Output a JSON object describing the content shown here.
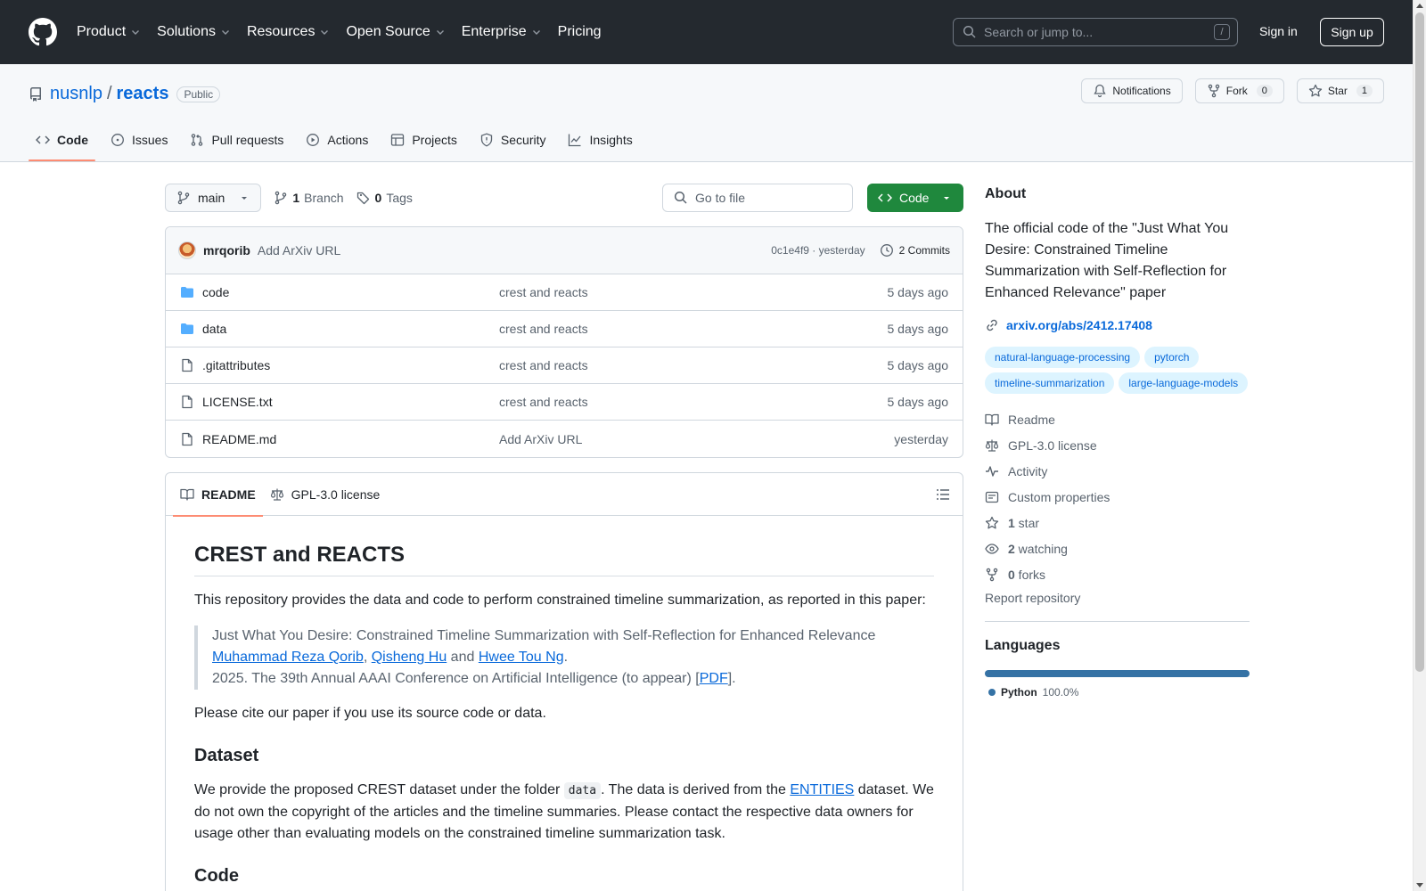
{
  "header": {
    "nav": [
      "Product",
      "Solutions",
      "Resources",
      "Open Source",
      "Enterprise"
    ],
    "pricing": "Pricing",
    "search_placeholder": "Search or jump to...",
    "search_key": "/",
    "sign_in": "Sign in",
    "sign_up": "Sign up"
  },
  "repo": {
    "owner": "nusnlp",
    "name": "reacts",
    "visibility": "Public",
    "notifications": "Notifications",
    "fork_label": "Fork",
    "fork_count": "0",
    "star_label": "Star",
    "star_count": "1",
    "tabs": [
      "Code",
      "Issues",
      "Pull requests",
      "Actions",
      "Projects",
      "Security",
      "Insights"
    ]
  },
  "toolbar": {
    "branch": "main",
    "branch_count": "1",
    "branch_label": "Branch",
    "tag_count": "0",
    "tag_label": "Tags",
    "goto_placeholder": "Go to file",
    "code_label": "Code"
  },
  "commit": {
    "author": "mrqorib",
    "message": "Add ArXiv URL",
    "hash_time": "0c1e4f9 · yesterday",
    "commits": "2 Commits"
  },
  "files": [
    {
      "name": "code",
      "message": "crest and reacts",
      "date": "5 days ago",
      "type": "folder"
    },
    {
      "name": "data",
      "message": "crest and reacts",
      "date": "5 days ago",
      "type": "folder"
    },
    {
      "name": ".gitattributes",
      "message": "crest and reacts",
      "date": "5 days ago",
      "type": "file"
    },
    {
      "name": "LICENSE.txt",
      "message": "crest and reacts",
      "date": "5 days ago",
      "type": "file"
    },
    {
      "name": "README.md",
      "message": "Add ArXiv URL",
      "date": "yesterday",
      "type": "file"
    }
  ],
  "readme": {
    "tab_readme": "README",
    "tab_license": "GPL-3.0 license",
    "h1": "CREST and REACTS",
    "intro": "This repository provides the data and code to perform constrained timeline summarization, as reported in this paper:",
    "quote_title": "Just What You Desire: Constrained Timeline Summarization with Self-Reflection for Enhanced Relevance",
    "author1": "Muhammad Reza Qorib",
    "sep1": ", ",
    "author2": "Qisheng Hu",
    "sep2": " and ",
    "author3": "Hwee Tou Ng",
    "sep3": ".",
    "venue": "2025. The 39th Annual AAAI Conference on Artificial Intelligence (to appear) [",
    "pdf": "PDF",
    "venue_end": "].",
    "cite": "Please cite our paper if you use its source code or data.",
    "h2_dataset": "Dataset",
    "dataset_p1": "We provide the proposed CREST dataset under the folder ",
    "dataset_code": "data",
    "dataset_p2": ". The data is derived from the ",
    "dataset_link": "ENTITIES",
    "dataset_p3": " dataset. We do not own the copyright of the articles and the timeline summaries. Please contact the respective data owners for usage other than evaluating models on the constrained timeline summarization task.",
    "h2_code": "Code"
  },
  "about": {
    "heading": "About",
    "description": "The official code of the \"Just What You Desire: Constrained Timeline Summarization with Self-Reflection for Enhanced Relevance\" paper",
    "link": "arxiv.org/abs/2412.17408",
    "topics": [
      "natural-language-processing",
      "pytorch",
      "timeline-summarization",
      "large-language-models"
    ],
    "readme": "Readme",
    "license": "GPL-3.0 license",
    "activity": "Activity",
    "custom_props": "Custom properties",
    "stars_count": "1",
    "stars_label": " star",
    "watching_count": "2",
    "watching_label": " watching",
    "forks_count": "0",
    "forks_label": " forks",
    "report": "Report repository"
  },
  "languages": {
    "heading": "Languages",
    "items": [
      {
        "name": "Python",
        "percent": "100.0%",
        "color": "#3572a5"
      }
    ]
  }
}
